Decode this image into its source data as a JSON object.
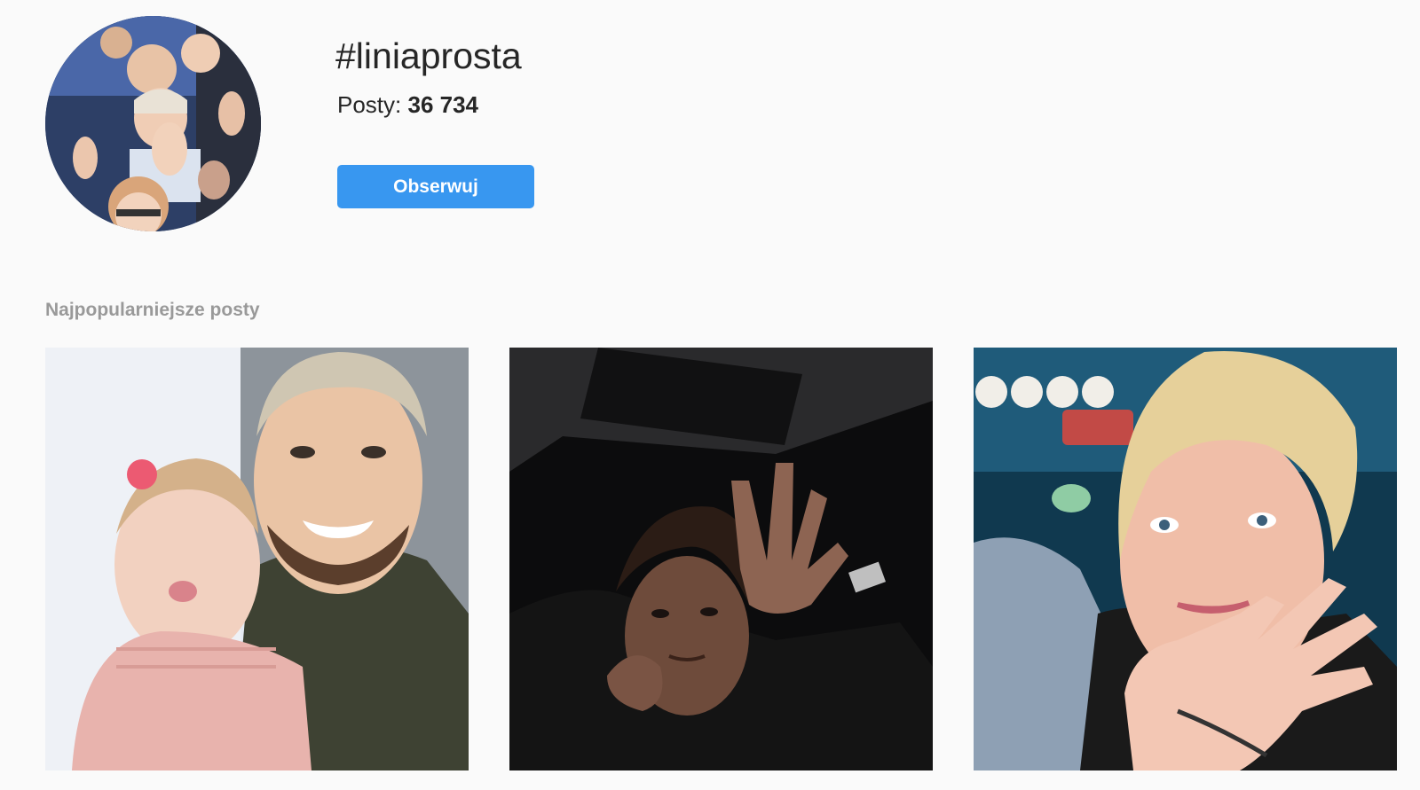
{
  "header": {
    "hashtag": "#liniaprosta",
    "posts_label": "Posty:",
    "posts_count": "36 734",
    "follow_label": "Obserwuj"
  },
  "top_posts": {
    "heading": "Najpopularniejsze posty",
    "items": [
      {
        "image": "photo-man-and-baby"
      },
      {
        "image": "photo-young-man-waving-dark"
      },
      {
        "image": "photo-blonde-woman-waving"
      }
    ]
  },
  "colors": {
    "accent": "#3897f0",
    "background": "#fafafa",
    "text": "#262626",
    "muted": "#999999"
  }
}
